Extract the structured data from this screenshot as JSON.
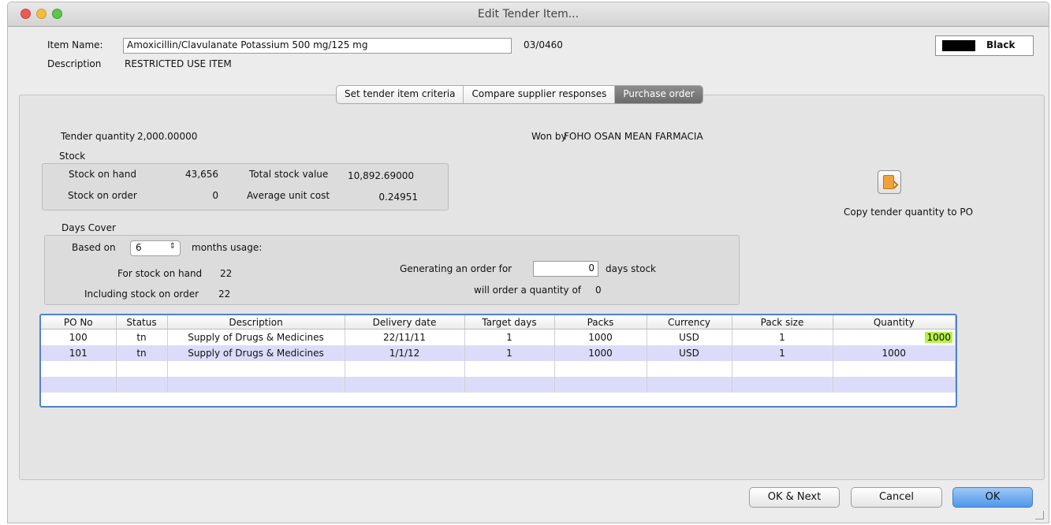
{
  "window": {
    "title": "Edit Tender Item..."
  },
  "item": {
    "name_label": "Item Name:",
    "name_value": "Amoxicillin/Clavulanate Potassium 500 mg/125 mg",
    "code": "03/0460",
    "description_label": "Description",
    "description_value": "RESTRICTED USE ITEM",
    "color_label": "Black",
    "color_hex": "#000000"
  },
  "tabs": [
    {
      "label": "Set tender item criteria",
      "active": false
    },
    {
      "label": "Compare supplier responses",
      "active": false
    },
    {
      "label": "Purchase order",
      "active": true
    }
  ],
  "summary": {
    "tender_quantity_label": "Tender quantity",
    "tender_quantity_value": "2,000.00000",
    "won_by_label": "Won by",
    "won_by_value": "FOHO OSAN MEAN FARMACIA"
  },
  "stock": {
    "group_label": "Stock",
    "on_hand_label": "Stock on hand",
    "on_hand_value": "43,656",
    "on_order_label": "Stock on order",
    "on_order_value": "0",
    "total_value_label": "Total stock value",
    "total_value_value": "10,892.69000",
    "avg_cost_label": "Average unit cost",
    "avg_cost_value": "0.24951"
  },
  "days_cover": {
    "group_label": "Days Cover",
    "based_on_label": "Based on",
    "months_selected": "6",
    "months_usage_label": "months usage:",
    "for_stock_on_hand_label": "For stock on hand",
    "for_stock_on_hand_value": "22",
    "including_on_order_label": "Including stock on order",
    "including_on_order_value": "22",
    "generating_label": "Generating an order for",
    "generating_value": "0",
    "days_stock_label": "days stock",
    "will_order_label": "will order a quantity of",
    "will_order_value": "0"
  },
  "copy_button": {
    "label": "Copy tender quantity to PO",
    "icon": "copy-quantity-icon"
  },
  "table": {
    "columns": [
      "PO No",
      "Status",
      "Description",
      "Delivery date",
      "Target days",
      "Packs",
      "Currency",
      "Pack size",
      "Quantity"
    ],
    "rows": [
      [
        "100",
        "tn",
        "Supply of Drugs & Medicines",
        "22/11/11",
        "1",
        "1000",
        "USD",
        "1",
        "1000"
      ],
      [
        "101",
        "tn",
        "Supply of Drugs & Medicines",
        "1/1/12",
        "1",
        "1000",
        "USD",
        "1",
        "1000"
      ]
    ]
  },
  "buttons": {
    "ok_next": "OK & Next",
    "cancel": "Cancel",
    "ok": "OK"
  },
  "colors": {
    "accent": "#4f97ec",
    "row_alt": "#dcdcfa",
    "highlight": "#b5f04b",
    "table_border": "#4f83c6"
  }
}
